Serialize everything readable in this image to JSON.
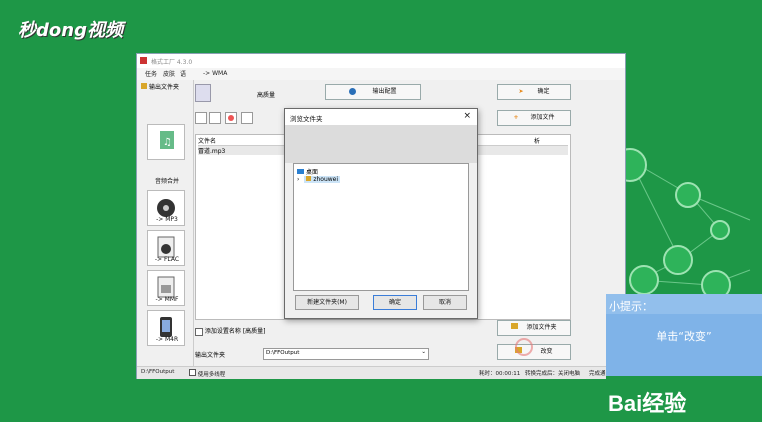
{
  "watermark_top": "秒dong视频",
  "app": {
    "title": "格式工厂 4.3.0",
    "menu": [
      "任务",
      "皮肤",
      "语"
    ],
    "output_folder_btn": "输出文件夹",
    "target_format": "-> WMA",
    "quality": "高质量",
    "output_config": "输出配置",
    "ok": "确定",
    "add_file": "添加文件",
    "add_folder": "添加文件夹",
    "change": "改变",
    "file_col": "文件名",
    "col_right": "析",
    "file_item": "冒道.mp3",
    "add_setting_label": "添加设置名称 [高质量]",
    "output_folder_label": "输出文件夹",
    "output_path": "D:\\FFOutput",
    "tiles": [
      {
        "label": "音频合并"
      },
      {
        "label": "-> MP3"
      },
      {
        "label": "-> FLAC"
      },
      {
        "label": "-> MMF"
      },
      {
        "label": "-> M4R"
      }
    ],
    "status": {
      "path": "D:\\FFOutput",
      "multithread": "使用多线程",
      "elapsed": "耗时：00:00:11",
      "shutdown": "转换完成后：关闭电脑",
      "notify": "完成通"
    }
  },
  "dialog": {
    "title": "浏览文件夹",
    "close": "×",
    "tree_desktop": "桌面",
    "tree_user": "zhouwei",
    "new_folder": "新建文件夹(M)",
    "ok": "确定",
    "cancel": "取消"
  },
  "tip": {
    "header": "小提示：",
    "text": "单击“改变”"
  },
  "baidu": "Bai经验",
  "colors": {
    "bg": "#1e9747",
    "tip": "#7fb3e8",
    "accent": "#0a64c8"
  }
}
